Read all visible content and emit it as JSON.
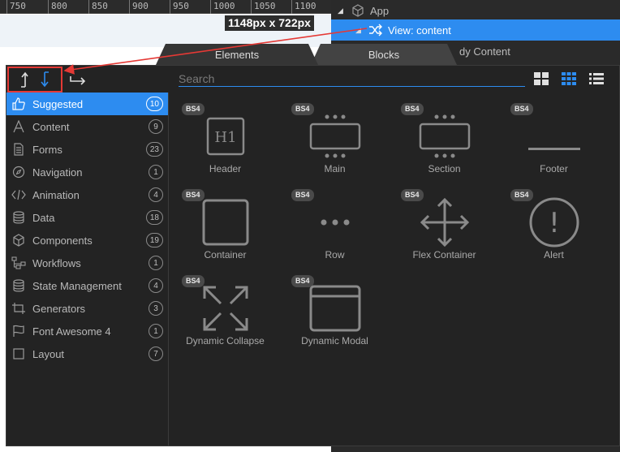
{
  "ruler": {
    "ticks": [
      "750",
      "800",
      "850",
      "900",
      "950",
      "1000",
      "1050",
      "1100"
    ]
  },
  "canvas": {
    "size_badge": "1148px x 722px"
  },
  "tree": {
    "items": [
      {
        "label": "App",
        "icon": "cube-icon"
      },
      {
        "label": "View: content",
        "icon": "shuffle-icon"
      },
      {
        "label": "Body Content",
        "partial": "dy Content"
      }
    ]
  },
  "tabs": {
    "elements": "Elements",
    "blocks": "Blocks"
  },
  "search": {
    "placeholder": "Search",
    "value": ""
  },
  "categories": [
    {
      "label": "Suggested",
      "count": "10",
      "icon": "thumbs-up-icon",
      "active": true
    },
    {
      "label": "Content",
      "count": "9",
      "icon": "font-a-icon"
    },
    {
      "label": "Forms",
      "count": "23",
      "icon": "form-document-icon"
    },
    {
      "label": "Navigation",
      "count": "1",
      "icon": "compass-icon"
    },
    {
      "label": "Animation",
      "count": "4",
      "icon": "code-icon"
    },
    {
      "label": "Data",
      "count": "18",
      "icon": "database-icon"
    },
    {
      "label": "Components",
      "count": "19",
      "icon": "cube-icon"
    },
    {
      "label": "Workflows",
      "count": "1",
      "icon": "sitemap-icon"
    },
    {
      "label": "State Management",
      "count": "4",
      "icon": "database-icon"
    },
    {
      "label": "Generators",
      "count": "3",
      "icon": "crop-icon"
    },
    {
      "label": "Font Awesome 4",
      "count": "1",
      "icon": "flag-icon"
    },
    {
      "label": "Layout",
      "count": "7",
      "icon": "square-icon"
    }
  ],
  "elements": [
    {
      "label": "Header",
      "badge": "BS4",
      "icon": "h1-icon",
      "glyph": "H1"
    },
    {
      "label": "Main",
      "badge": "BS4",
      "icon": "main-box-icon"
    },
    {
      "label": "Section",
      "badge": "BS4",
      "icon": "section-box-icon"
    },
    {
      "label": "Footer",
      "badge": "BS4",
      "icon": "footer-line-icon"
    },
    {
      "label": "Container",
      "badge": "BS4",
      "icon": "container-square-icon"
    },
    {
      "label": "Row",
      "badge": "BS4",
      "icon": "row-dots-icon"
    },
    {
      "label": "Flex Container",
      "badge": "BS4",
      "icon": "move-arrows-icon"
    },
    {
      "label": "Alert",
      "badge": "BS4",
      "icon": "alert-circle-icon",
      "glyph": "!"
    },
    {
      "label": "Dynamic Collapse",
      "badge": "BS4",
      "icon": "expand-arrows-icon"
    },
    {
      "label": "Dynamic Modal",
      "badge": "BS4",
      "icon": "modal-window-icon"
    }
  ],
  "colors": {
    "accent": "#2d8cf0",
    "annotation": "#e53935",
    "panel_bg": "#232323"
  }
}
